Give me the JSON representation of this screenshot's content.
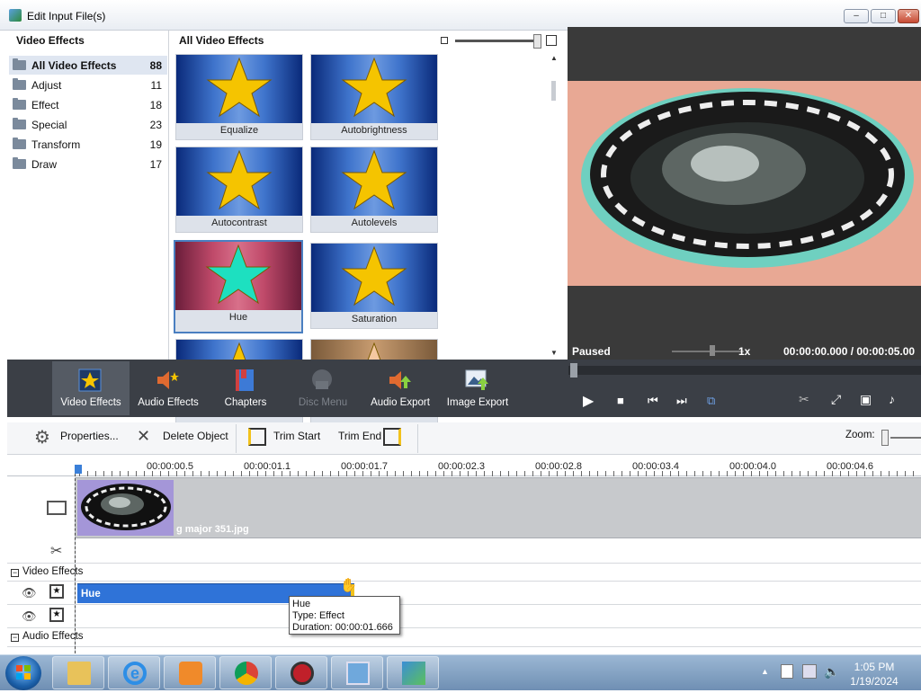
{
  "window": {
    "title": "Edit Input File(s)",
    "min": "–",
    "max": "□",
    "close": "✕"
  },
  "categories": {
    "header": "Video Effects",
    "items": [
      {
        "label": "All Video Effects",
        "count": "88"
      },
      {
        "label": "Adjust",
        "count": "11"
      },
      {
        "label": "Effect",
        "count": "18"
      },
      {
        "label": "Special",
        "count": "23"
      },
      {
        "label": "Transform",
        "count": "19"
      },
      {
        "label": "Draw",
        "count": "17"
      }
    ]
  },
  "effects": {
    "header": "All Video Effects",
    "tiles": [
      {
        "name": "Equalize",
        "style": "blue"
      },
      {
        "name": "Autobrightness",
        "style": "blue"
      },
      {
        "name": "Autocontrast",
        "style": "blue"
      },
      {
        "name": "Autolevels",
        "style": "blue"
      },
      {
        "name": "Hue",
        "style": "red"
      },
      {
        "name": "Saturation",
        "style": "blue"
      },
      {
        "name": "",
        "style": "blue"
      },
      {
        "name": "",
        "style": "tan"
      }
    ],
    "selected_index": 4
  },
  "preview": {
    "status": "Paused",
    "speed": "1x",
    "time": "00:00:00.000  /  00:00:05.00"
  },
  "toolbar": {
    "video_effects": "Video Effects",
    "audio_effects": "Audio Effects",
    "chapters": "Chapters",
    "disc_menu": "Disc Menu",
    "audio_export": "Audio Export",
    "image_export": "Image Export"
  },
  "edit_toolbar": {
    "properties": "Properties...",
    "delete_object": "Delete Object",
    "trim_start": "Trim Start",
    "trim_end": "Trim End",
    "zoom": "Zoom:"
  },
  "timeline": {
    "ticks": [
      "00:00:00.5",
      "00:00:01.1",
      "00:00:01.7",
      "00:00:02.3",
      "00:00:02.8",
      "00:00:03.4",
      "00:00:04.0",
      "00:00:04.6"
    ],
    "clip_name": "g major 351.jpg",
    "video_effects_section": "Video Effects",
    "audio_effects_section": "Audio Effects",
    "effect_bar_label": "Hue"
  },
  "tooltip": {
    "line1": "Hue",
    "line2": "Type: Effect",
    "line3": "Duration:  00:00:01.666"
  },
  "clock": {
    "time": "1:05 PM",
    "date": "1/19/2024"
  },
  "colors": {
    "accent": "#2f73d8",
    "toolbar_bg": "#3b3f46",
    "preview_bg": "#3a3a3a"
  }
}
